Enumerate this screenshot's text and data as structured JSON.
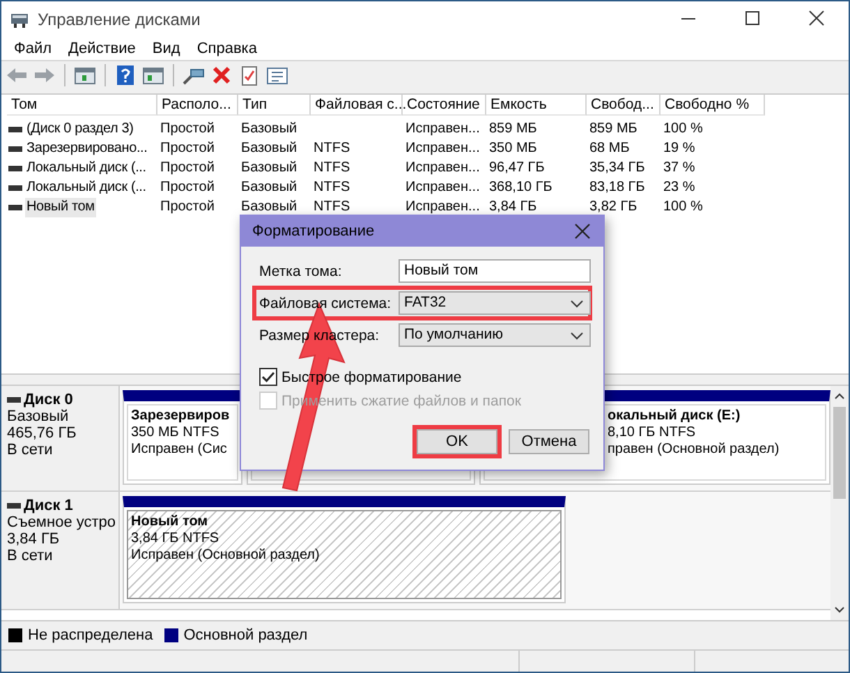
{
  "window": {
    "title": "Управление дисками"
  },
  "menu": [
    {
      "label": "Файл"
    },
    {
      "label": "Действие"
    },
    {
      "label": "Вид"
    },
    {
      "label": "Справка"
    }
  ],
  "table": {
    "columns": [
      "Том",
      "Располо...",
      "Тип",
      "Файловая с...",
      "Состояние",
      "Емкость",
      "Свобод...",
      "Свободно %"
    ],
    "rows": [
      {
        "volume": "(Диск 0 раздел 3)",
        "layout": "Простой",
        "type": "Базовый",
        "status": "Исправен...",
        "capacity": "859 МБ",
        "free_space": "859 МБ",
        "free_percent": "100 %",
        "selected": false
      },
      {
        "volume": "Зарезервировано...",
        "layout": "Простой",
        "type": "Базовый",
        "file_system": "NTFS",
        "status": "Исправен...",
        "capacity": "350 МБ",
        "free_space": "68 МБ",
        "free_percent": "19 %",
        "selected": false
      },
      {
        "volume": "Локальный диск (...",
        "layout": "Простой",
        "type": "Базовый",
        "file_system": "NTFS",
        "status": "Исправен...",
        "capacity": "96,47 ГБ",
        "free_space": "35,34 ГБ",
        "free_percent": "37 %",
        "selected": false
      },
      {
        "volume": "Локальный диск (...",
        "layout": "Простой",
        "type": "Базовый",
        "file_system": "NTFS",
        "status": "Исправен...",
        "capacity": "368,10 ГБ",
        "free_space": "83,18 ГБ",
        "free_percent": "23 %",
        "selected": false
      },
      {
        "volume": "Новый том",
        "layout": "Простой",
        "type": "Базовый",
        "file_system": "NTFS",
        "status": "Исправен...",
        "capacity": "3,84 ГБ",
        "free_space": "3,82 ГБ",
        "free_percent": "100 %",
        "selected": true
      }
    ]
  },
  "disks": [
    {
      "name": "Диск 0",
      "details": [
        "Базовый",
        "465,76 ГБ",
        "В сети"
      ],
      "partitions": [
        {
          "kind": "primary",
          "selected": false,
          "lines": [
            "Зарезервиров",
            "350 МБ NTFS",
            "Исправен (Сис"
          ]
        },
        {
          "kind": "primary",
          "selected": false
        },
        {
          "kind": "primary",
          "selected": false,
          "lines": [
            "окальный диск  (E:)",
            "8,10 ГБ NTFS",
            "правен (Основной раздел)"
          ]
        }
      ]
    },
    {
      "name": "Диск 1",
      "details": [
        "Съемное устро",
        "3,84 ГБ",
        "В сети"
      ],
      "partitions": [
        {
          "kind": "primary",
          "selected": true,
          "lines": [
            "Новый том",
            "3,84 ГБ NTFS",
            "Исправен (Основной раздел)"
          ]
        }
      ]
    }
  ],
  "legend": [
    {
      "label": "Не распределена",
      "color": "#000000"
    },
    {
      "label": "Основной раздел",
      "color": "#000080"
    }
  ],
  "dialog": {
    "title": "Форматирование",
    "fields": [
      {
        "label": "Метка тома:",
        "kind": "text",
        "value": "Новый том",
        "highlighted": false
      },
      {
        "label": "Файловая система:",
        "kind": "select",
        "value": "FAT32",
        "highlighted": true
      },
      {
        "label": "Размер кластера:",
        "kind": "select",
        "value": "По умолчанию",
        "highlighted": false
      }
    ],
    "checkboxes": [
      {
        "label": "Быстрое форматирование",
        "checked": true,
        "disabled": false
      },
      {
        "label": "Применить сжатие файлов и папок",
        "checked": false,
        "disabled": true
      }
    ],
    "buttons": [
      {
        "label": "OK",
        "highlighted": true
      },
      {
        "label": "Отмена",
        "highlighted": false
      }
    ]
  }
}
